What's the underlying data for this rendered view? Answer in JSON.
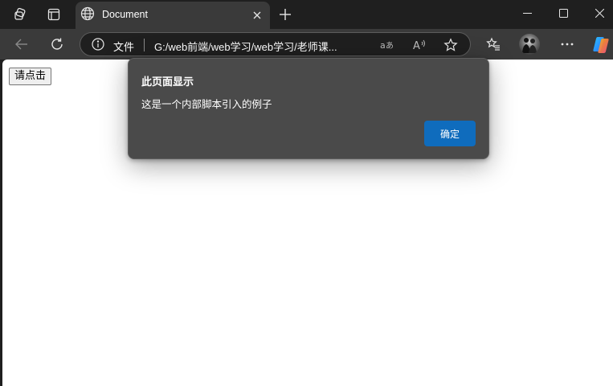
{
  "browser": {
    "tab": {
      "title": "Document"
    },
    "address_bar": {
      "security_label": "文件",
      "url": "G:/web前端/web学习/web学习/老师课..."
    },
    "toolbar_icons": [
      "back-icon",
      "refresh-icon",
      "info-icon",
      "read-aloud-icon",
      "text-size-icon",
      "favorite-star-icon",
      "favorites-list-icon",
      "profile-avatar",
      "more-icon",
      "copilot-icon"
    ]
  },
  "page": {
    "button_label": "请点击"
  },
  "dialog": {
    "title": "此页面显示",
    "message": "这是一个内部脚本引入的例子",
    "ok_label": "确定"
  },
  "colors": {
    "accent": "#0f6cbd",
    "dialog_bg": "#4a4a4a",
    "chrome_bg": "#1f1f1f",
    "toolbar_bg": "#3a3a3a"
  }
}
